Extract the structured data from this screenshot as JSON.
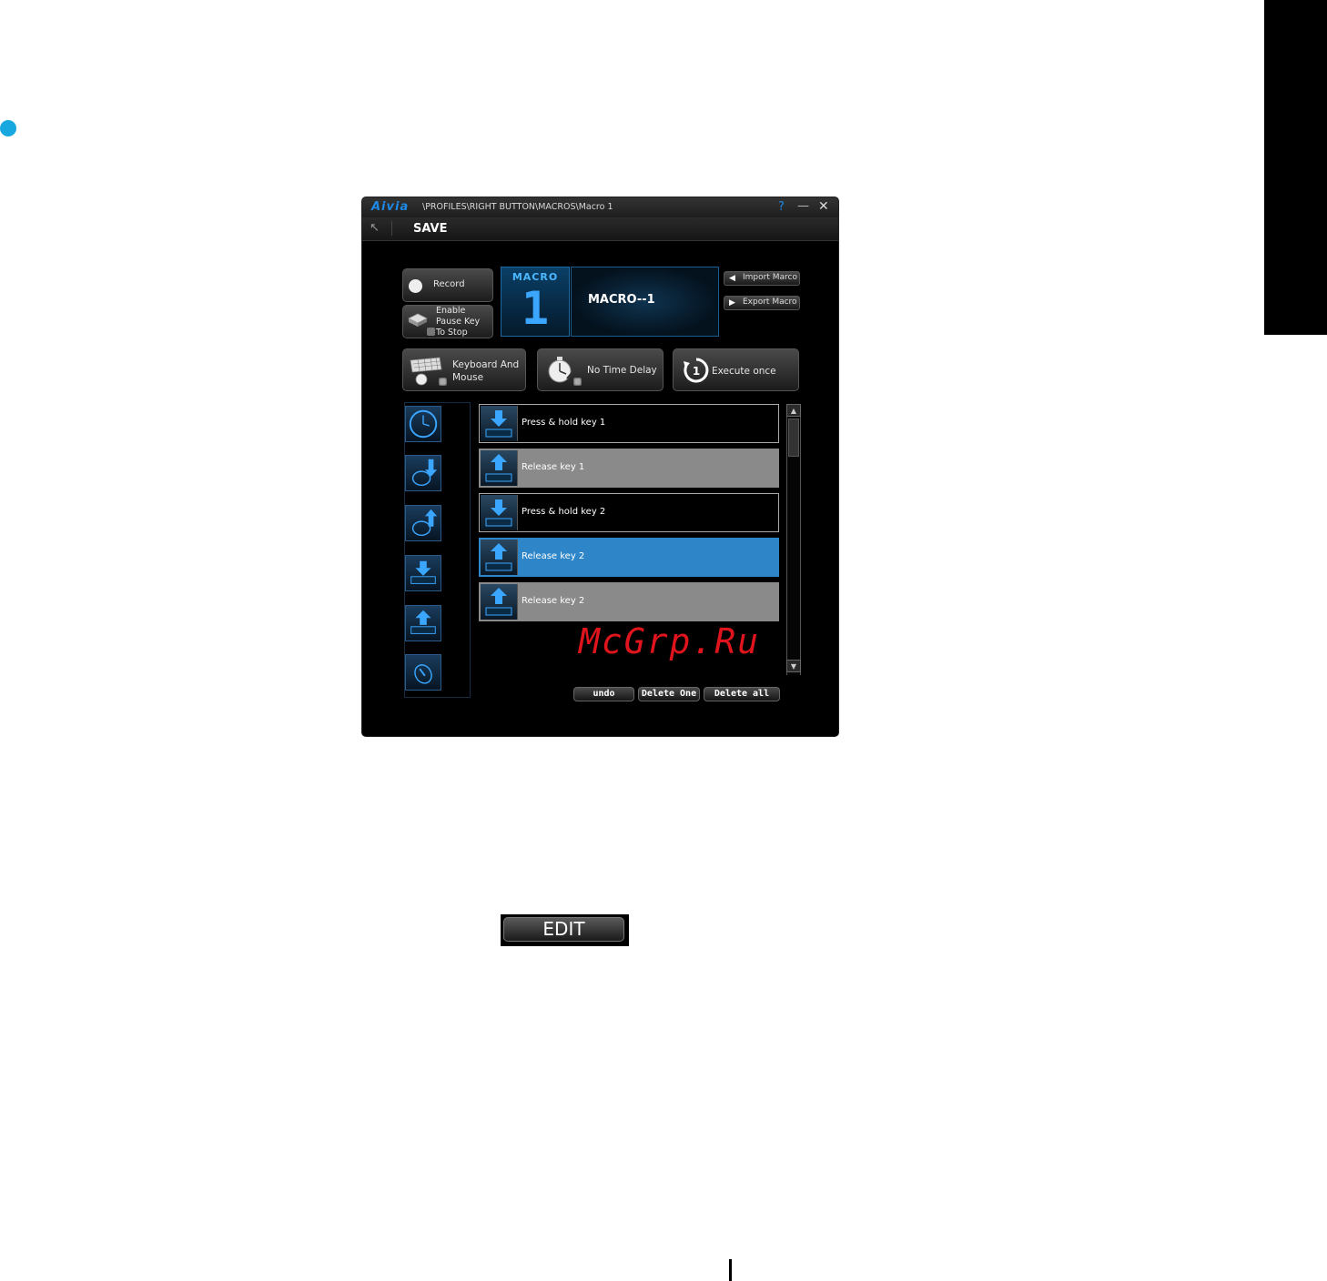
{
  "window": {
    "logo": "Aivia",
    "path": "\\PROFILES\\RIGHT BUTTON\\MACROS\\Macro 1",
    "help": "?",
    "minimize": "—",
    "close": "✕"
  },
  "toolbar": {
    "back": "↖",
    "save_label": "SAVE"
  },
  "record": {
    "label": "Record"
  },
  "pause": {
    "line1": "Enable",
    "line2": "Pause Key",
    "line3": "To Stop"
  },
  "macro": {
    "tile_label": "MACRO",
    "tile_number": "1",
    "name": "MACRO--1"
  },
  "import_label": "Import Marco",
  "export_label": "Export Macro",
  "options": {
    "input_line1": "Keyboard And",
    "input_line2": "Mouse",
    "delay": "No Time Delay",
    "execute": "Execute once"
  },
  "palette": [
    "timer-icon",
    "mouse-down-icon",
    "mouse-up-icon",
    "key-down-icon",
    "key-up-icon",
    "mouse-scroll-icon"
  ],
  "rows": [
    {
      "label": "Press & hold key 1",
      "direction": "down",
      "style": "normal"
    },
    {
      "label": "Release key 1",
      "direction": "up",
      "style": "gray"
    },
    {
      "label": "Press & hold key 2",
      "direction": "down",
      "style": "normal"
    },
    {
      "label": "Release key 2",
      "direction": "up",
      "style": "selected"
    },
    {
      "label": "Release key 2",
      "direction": "up",
      "style": "gray"
    }
  ],
  "actions": {
    "undo": "undo",
    "delete_one": "Delete One",
    "delete_all": "Delete all"
  },
  "watermark": "McGrp.Ru",
  "edit_label": "EDIT",
  "colors": {
    "accent": "#18a8e0",
    "selected_row": "#2e86c8",
    "gray_row": "#8a8a8a",
    "watermark": "#e0141c"
  }
}
